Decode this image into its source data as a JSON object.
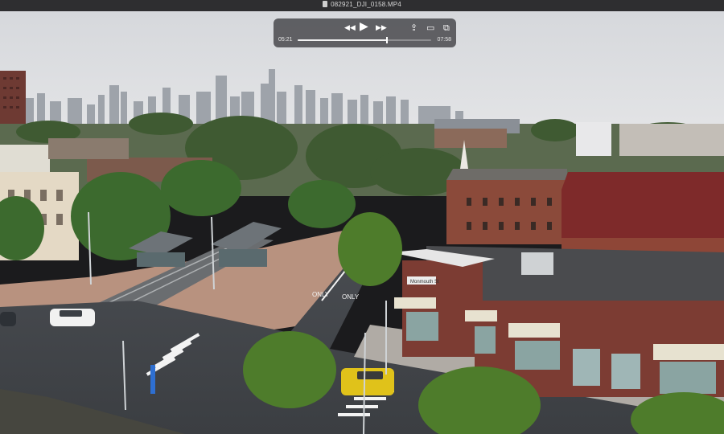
{
  "window": {
    "title": "082921_DJI_0158.MP4"
  },
  "player": {
    "current_time": "05:21",
    "duration": "07:58",
    "progress": 0.67,
    "controls": {
      "rewind_icon": "rewind-icon",
      "play_icon": "play-icon",
      "fast_forward_icon": "fast-forward-icon",
      "share_icon": "share-icon",
      "airplay_icon": "airplay-icon",
      "pip_icon": "picture-in-picture-icon"
    }
  },
  "scene_signs": {
    "station_sign": "Monmouth St",
    "road_marking_left": "ONLY",
    "road_marking_right": "ONLY"
  },
  "colors": {
    "sky": "#d9dbde",
    "brick": "#7c3c33",
    "roof_red": "#7e2a2a",
    "taxi": "#e0c21a"
  }
}
